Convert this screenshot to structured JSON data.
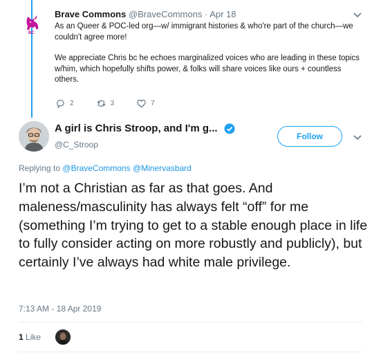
{
  "parent_tweet": {
    "name": "Brave Commons",
    "handle": "@BraveCommons",
    "separator": "·",
    "date": "Apr 18",
    "avatar_text": "BC",
    "paragraphs": [
      "As an Queer & POC-led org—w/ immigrant histories & who're part of the church—we couldn't agree more!",
      "We appreciate Chris bc he echoes  marginalized voices who are leading in these topics w/him, which hopefully shifts power, & folks will share voices like ours + countless others."
    ],
    "reply_count": "2",
    "retweet_count": "3",
    "like_count": "7"
  },
  "main_tweet": {
    "display_name": "A girl is Chris Stroop, and I'm g...",
    "handle": "@C_Stroop",
    "follow_label": "Follow",
    "replying_prefix": "Replying to",
    "replying_to": [
      "@BraveCommons",
      "@Minervasbard"
    ],
    "text": "I’m not a Christian as far as that goes. And maleness/masculinity has always felt “off” for me (something I’m trying to get to a stable enough place in life to fully consider acting on more robustly and publicly), but certainly I’ve always had white male privilege.",
    "timestamp": "7:13 AM - 18 Apr 2019",
    "like_count": "1",
    "like_label": "Like"
  },
  "colors": {
    "accent": "#1da1f2",
    "link": "#1b95e0",
    "muted": "#657786",
    "text": "#14171a",
    "divider": "#e6ecf0"
  },
  "icons": [
    "chevron-down-icon",
    "reply-icon",
    "retweet-icon",
    "heart-icon",
    "verified-badge-icon"
  ]
}
